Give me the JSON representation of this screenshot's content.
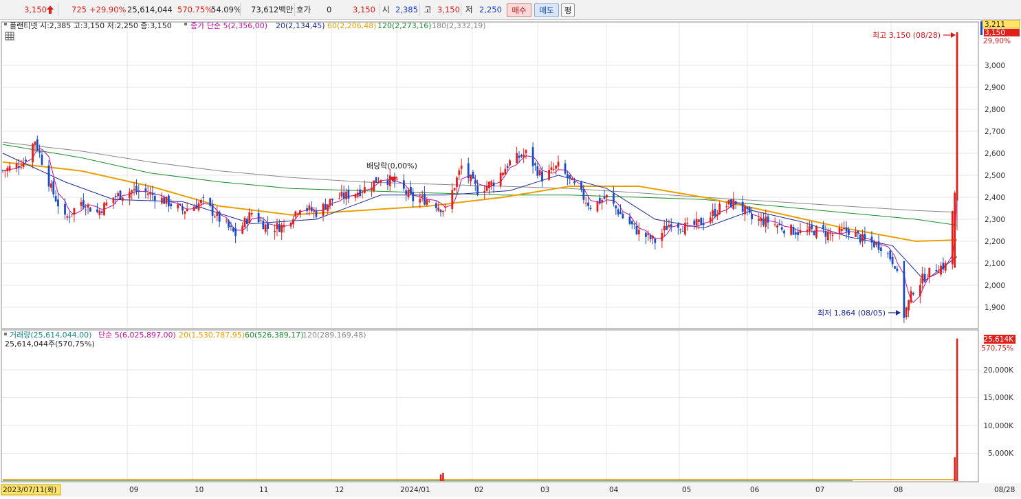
{
  "quote_bar": {
    "price": "3,150",
    "change": "725",
    "change_pct": "+29.90%",
    "volume": "25,614,044",
    "volume_ratio": "570.75%",
    "turnover": "54.09%",
    "amount": "73,612백만",
    "hoga_label": "호가",
    "hoga_value": "0",
    "hoga_price": "3,150",
    "open_label": "시",
    "open_value": "2,385",
    "high_label": "고",
    "high_value": "3,150",
    "low_label": "저",
    "low_value": "2,250",
    "buy_label": "매수",
    "sell_label": "매도",
    "flat_label": "평"
  },
  "price_legend": {
    "stock_info": "플랜티넷 시:2,385 고:3,150 저:2,250 종:3,150",
    "ma5": "종가 단순 5(2,356,00)",
    "ma20": "20(2,134,45)",
    "ma60": "60(2,206,48)",
    "ma120": "120(2,273,16)",
    "ma180": "180(2,332,19)"
  },
  "volume_legend": {
    "vol": "거래량(25,614,044,00)",
    "ma5": "단순 5(6,025,897,00)",
    "ma20": "20(1,530,787,95)",
    "ma60": "60(526,389,17)",
    "ma120": "120(289,169,48)",
    "current": "25,614,044주(570,75%)"
  },
  "annotations": {
    "high": "최고 3,150 (08/28)",
    "low": "최저 1,864 (08/05)",
    "dividend": "배당락(0,00%)"
  },
  "price_axis": {
    "labels": [
      "3,000",
      "2,900",
      "2,800",
      "2,700",
      "2,600",
      "2,500",
      "2,400",
      "2,300",
      "2,200",
      "2,100",
      "2,000",
      "1,900"
    ],
    "tag_top": "3,211",
    "tag_price": "3,150",
    "tag_pct": "29,90%"
  },
  "volume_axis": {
    "labels": [
      "20,000K",
      "15,000K",
      "10,000K",
      "5,000K"
    ],
    "tag_value": "25,614K",
    "tag_pct": "570,75%"
  },
  "date_axis": {
    "labels": [
      "2023/07/11(화)",
      "09",
      "10",
      "11",
      "12",
      "2024/01",
      "02",
      "03",
      "04",
      "05",
      "06",
      "07",
      "08",
      "08/28"
    ]
  },
  "colors": {
    "up": "#e0201b",
    "down": "#1a4cc8",
    "ma5": "#c010a0",
    "ma20": "#1a2a9a",
    "ma60": "#e8a000",
    "ma120": "#1a8a2a",
    "ma180": "#888888"
  },
  "chart_data": {
    "type": "candlestick",
    "title": "플랜티넷",
    "ylim": [
      1820,
      3250
    ],
    "volume_ylim": [
      0,
      25700
    ],
    "months": [
      "2023-07",
      "2023-08",
      "2023-09",
      "2023-10",
      "2023-11",
      "2023-12",
      "2024-01",
      "2024-02",
      "2024-03",
      "2024-04",
      "2024-05",
      "2024-06",
      "2024-07",
      "2024-08"
    ],
    "close_path": [
      [
        "2023-07-11",
        2520
      ],
      [
        "2023-07-20",
        2560
      ],
      [
        "2023-07-25",
        2660
      ],
      [
        "2023-08-01",
        2440
      ],
      [
        "2023-08-07",
        2300
      ],
      [
        "2023-08-14",
        2380
      ],
      [
        "2023-08-21",
        2330
      ],
      [
        "2023-08-28",
        2400
      ],
      [
        "2023-09-05",
        2430
      ],
      [
        "2023-09-12",
        2420
      ],
      [
        "2023-09-20",
        2380
      ],
      [
        "2023-09-27",
        2340
      ],
      [
        "2023-10-06",
        2380
      ],
      [
        "2023-10-13",
        2300
      ],
      [
        "2023-10-20",
        2230
      ],
      [
        "2023-10-27",
        2330
      ],
      [
        "2023-11-03",
        2260
      ],
      [
        "2023-11-10",
        2270
      ],
      [
        "2023-11-17",
        2360
      ],
      [
        "2023-11-24",
        2330
      ],
      [
        "2023-12-01",
        2390
      ],
      [
        "2023-12-08",
        2410
      ],
      [
        "2023-12-15",
        2440
      ],
      [
        "2023-12-22",
        2490
      ],
      [
        "2023-12-28",
        2470
      ],
      [
        "2024-01-05",
        2390
      ],
      [
        "2024-01-12",
        2390
      ],
      [
        "2024-01-19",
        2340
      ],
      [
        "2024-01-26",
        2540
      ],
      [
        "2024-02-02",
        2430
      ],
      [
        "2024-02-09",
        2470
      ],
      [
        "2024-02-16",
        2560
      ],
      [
        "2024-02-23",
        2600
      ],
      [
        "2024-03-01",
        2490
      ],
      [
        "2024-03-08",
        2540
      ],
      [
        "2024-03-15",
        2450
      ],
      [
        "2024-03-22",
        2360
      ],
      [
        "2024-03-29",
        2400
      ],
      [
        "2024-04-05",
        2310
      ],
      [
        "2024-04-12",
        2240
      ],
      [
        "2024-04-19",
        2200
      ],
      [
        "2024-04-26",
        2290
      ],
      [
        "2024-05-03",
        2260
      ],
      [
        "2024-05-10",
        2290
      ],
      [
        "2024-05-17",
        2350
      ],
      [
        "2024-05-24",
        2380
      ],
      [
        "2024-05-31",
        2300
      ],
      [
        "2024-06-07",
        2290
      ],
      [
        "2024-06-14",
        2260
      ],
      [
        "2024-06-21",
        2240
      ],
      [
        "2024-06-28",
        2250
      ],
      [
        "2024-07-05",
        2230
      ],
      [
        "2024-07-12",
        2250
      ],
      [
        "2024-07-19",
        2200
      ],
      [
        "2024-07-26",
        2180
      ],
      [
        "2024-08-01",
        2100
      ],
      [
        "2024-08-05",
        1864
      ],
      [
        "2024-08-09",
        1980
      ],
      [
        "2024-08-14",
        2040
      ],
      [
        "2024-08-19",
        2080
      ],
      [
        "2024-08-23",
        2090
      ],
      [
        "2024-08-27",
        2420
      ],
      [
        "2024-08-28",
        3150
      ]
    ],
    "ma20_path": [
      [
        "2023-07-11",
        2600
      ],
      [
        "2023-08-07",
        2470
      ],
      [
        "2023-08-28",
        2390
      ],
      [
        "2023-09-27",
        2380
      ],
      [
        "2023-10-27",
        2280
      ],
      [
        "2023-11-24",
        2300
      ],
      [
        "2023-12-22",
        2410
      ],
      [
        "2024-01-19",
        2410
      ],
      [
        "2024-02-16",
        2430
      ],
      [
        "2024-03-08",
        2500
      ],
      [
        "2024-03-29",
        2440
      ],
      [
        "2024-04-19",
        2300
      ],
      [
        "2024-05-10",
        2260
      ],
      [
        "2024-05-31",
        2340
      ],
      [
        "2024-06-21",
        2290
      ],
      [
        "2024-07-12",
        2220
      ],
      [
        "2024-07-31",
        2180
      ],
      [
        "2024-08-14",
        2020
      ],
      [
        "2024-08-28",
        2130
      ]
    ],
    "ma60_path": [
      [
        "2023-07-11",
        2560
      ],
      [
        "2023-08-14",
        2520
      ],
      [
        "2023-09-13",
        2450
      ],
      [
        "2023-10-13",
        2360
      ],
      [
        "2023-11-13",
        2320
      ],
      [
        "2023-12-13",
        2340
      ],
      [
        "2024-01-12",
        2360
      ],
      [
        "2024-02-13",
        2400
      ],
      [
        "2024-03-13",
        2450
      ],
      [
        "2024-04-12",
        2450
      ],
      [
        "2024-05-10",
        2400
      ],
      [
        "2024-06-10",
        2330
      ],
      [
        "2024-07-10",
        2260
      ],
      [
        "2024-08-10",
        2200
      ],
      [
        "2024-08-28",
        2206
      ]
    ],
    "ma120_path": [
      [
        "2023-07-11",
        2640
      ],
      [
        "2023-08-14",
        2580
      ],
      [
        "2023-09-13",
        2510
      ],
      [
        "2023-10-13",
        2470
      ],
      [
        "2023-11-13",
        2440
      ],
      [
        "2023-12-13",
        2430
      ],
      [
        "2024-01-12",
        2420
      ],
      [
        "2024-02-13",
        2410
      ],
      [
        "2024-03-13",
        2410
      ],
      [
        "2024-04-12",
        2400
      ],
      [
        "2024-05-10",
        2390
      ],
      [
        "2024-06-10",
        2360
      ],
      [
        "2024-07-10",
        2330
      ],
      [
        "2024-08-10",
        2300
      ],
      [
        "2024-08-28",
        2273
      ]
    ],
    "ma180_path": [
      [
        "2023-07-11",
        2650
      ],
      [
        "2023-08-14",
        2610
      ],
      [
        "2023-09-13",
        2560
      ],
      [
        "2023-10-13",
        2520
      ],
      [
        "2023-11-13",
        2490
      ],
      [
        "2023-12-13",
        2470
      ],
      [
        "2024-01-12",
        2460
      ],
      [
        "2024-02-13",
        2450
      ],
      [
        "2024-03-13",
        2440
      ],
      [
        "2024-04-12",
        2420
      ],
      [
        "2024-05-10",
        2400
      ],
      [
        "2024-06-10",
        2380
      ],
      [
        "2024-07-10",
        2360
      ],
      [
        "2024-08-10",
        2340
      ],
      [
        "2024-08-28",
        2332
      ]
    ],
    "volume_spikes": [
      [
        "2024-01-17",
        1200
      ],
      [
        "2024-01-18",
        1500
      ],
      [
        "2024-08-27",
        4300
      ],
      [
        "2024-08-28",
        25614
      ]
    ],
    "baseline_volume": 150
  }
}
